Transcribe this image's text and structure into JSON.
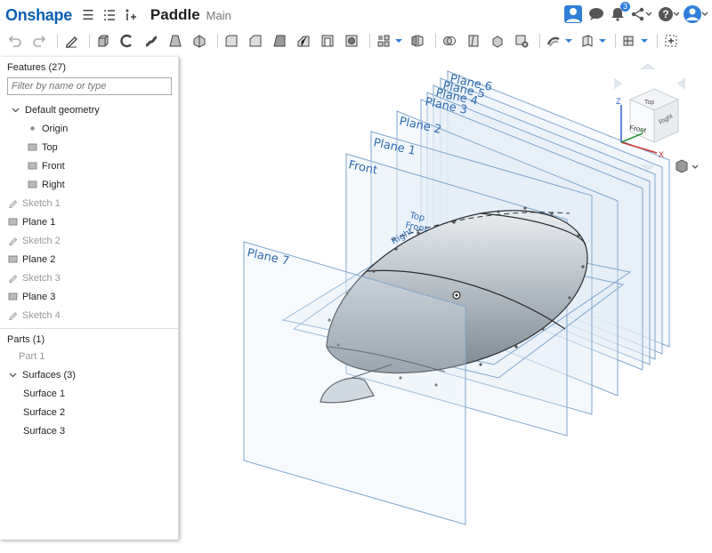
{
  "app": {
    "logo": "Onshape",
    "doc_title": "Paddle",
    "workspace": "Main",
    "notifications_count": "3"
  },
  "features": {
    "header": "Features (27)",
    "filter_placeholder": "Filter by name or type",
    "default_geometry": "Default geometry",
    "geometry_items": [
      "Origin",
      "Top",
      "Front",
      "Right"
    ],
    "items": [
      {
        "label": "Sketch 1",
        "kind": "sketch"
      },
      {
        "label": "Plane 1",
        "kind": "plane"
      },
      {
        "label": "Sketch 2",
        "kind": "sketch"
      },
      {
        "label": "Plane 2",
        "kind": "plane"
      },
      {
        "label": "Sketch 3",
        "kind": "sketch"
      },
      {
        "label": "Plane 3",
        "kind": "plane"
      },
      {
        "label": "Sketch 4",
        "kind": "sketch"
      }
    ]
  },
  "parts": {
    "header": "Parts (1)",
    "part": "Part 1",
    "surfaces_header": "Surfaces (3)",
    "surfaces": [
      "Surface 1",
      "Surface 2",
      "Surface 3"
    ]
  },
  "viewport": {
    "plane_labels": [
      "Plane 6",
      "Plane 5",
      "Plane 4",
      "Plane 3",
      "Plane 2",
      "Plane 1",
      "Front",
      "Plane 7"
    ],
    "small_labels": [
      "Top",
      "Front",
      "Right"
    ],
    "view_cube": {
      "top": "Top",
      "front": "Front",
      "right": "Right",
      "axis_x": "X",
      "axis_y": "Y",
      "axis_z": "Z"
    }
  },
  "colors": {
    "brand": "#0a5fb4",
    "plane_stroke": "#7fa6cc",
    "plane_fill": "#e6eef7",
    "label": "#2e6cb0",
    "body": "#9aa4ad"
  }
}
